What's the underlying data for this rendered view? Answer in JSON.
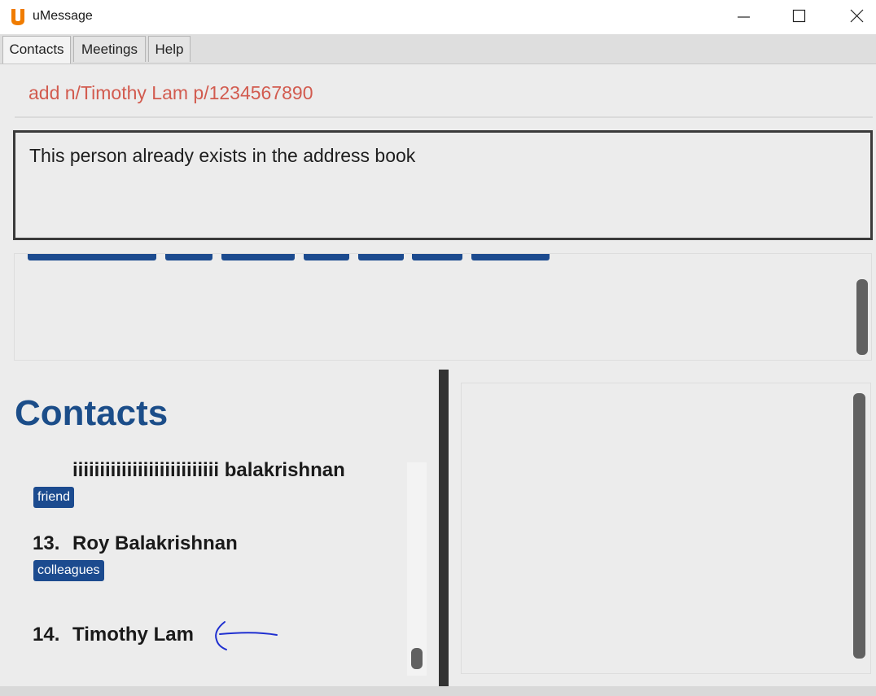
{
  "window": {
    "title": "uMessage",
    "logo_letter": "u",
    "accent_color": "#f07c00"
  },
  "tabs": [
    {
      "label": "Contacts",
      "active": true
    },
    {
      "label": "Meetings",
      "active": false
    },
    {
      "label": "Help",
      "active": false
    }
  ],
  "command": {
    "value": "add n/Timothy Lam p/1234567890",
    "text_color": "#d25b4f"
  },
  "result": {
    "message": "This person already exists in the address book"
  },
  "contacts": {
    "heading": "Contacts",
    "items": [
      {
        "index": "",
        "name": "iiiiiiiiiiiiiiiiiiiiiiiiiii balakrishnan",
        "tags": [
          "friend"
        ]
      },
      {
        "index": "13.",
        "name": "Roy Balakrishnan",
        "tags": [
          "colleagues"
        ]
      },
      {
        "index": "14.",
        "name": "Timothy Lam",
        "tags": []
      }
    ]
  },
  "annotation": {
    "type": "hand-drawn arrow",
    "color": "#1f2fd0"
  },
  "colors": {
    "tag_bg": "#1c4b8f",
    "heading": "#1b4d89",
    "scroll_thumb": "#616161"
  }
}
